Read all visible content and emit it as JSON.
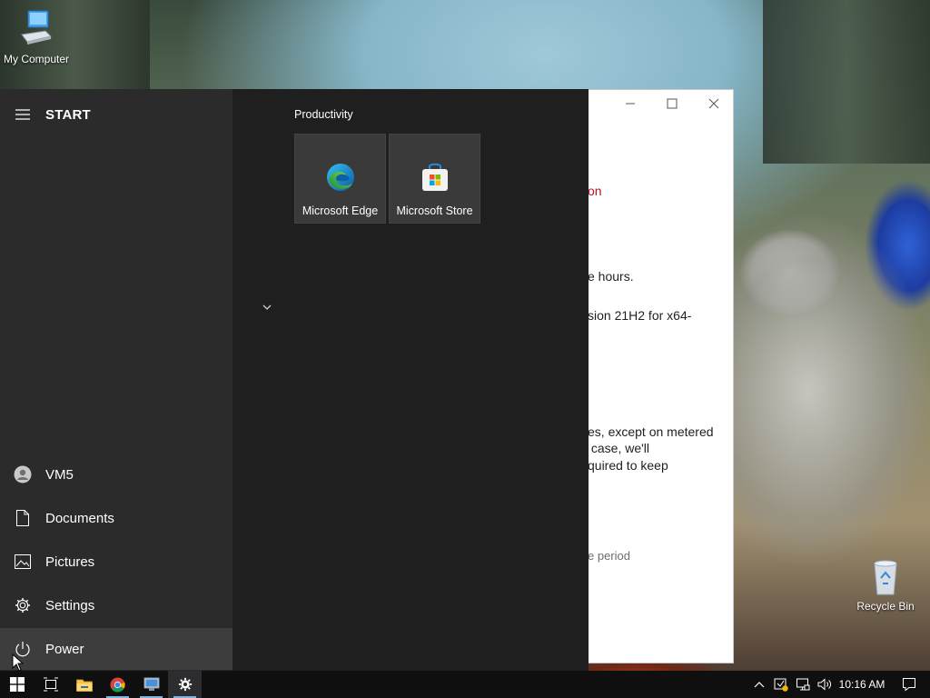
{
  "desktop": {
    "icons": [
      {
        "label": "My Computer"
      },
      {
        "label": "Recycle Bin"
      }
    ]
  },
  "background_window": {
    "text_lines": [
      "on",
      "e hours.",
      "sion 21H2 for x64-",
      "es, except on metered",
      " case, we'll",
      "quired to keep",
      "e period"
    ],
    "colors": {
      "highlight_text": "#c50f1f",
      "muted_text": "#6d6d6d"
    }
  },
  "start_menu": {
    "title": "START",
    "rail": {
      "user": "VM5",
      "documents": "Documents",
      "pictures": "Pictures",
      "settings": "Settings",
      "power": "Power"
    },
    "group_label": "Productivity",
    "tiles": [
      {
        "label": "Microsoft Edge",
        "icon": "edge-icon"
      },
      {
        "label": "Microsoft Store",
        "icon": "store-icon"
      }
    ]
  },
  "taskbar": {
    "apps": [
      "start-button",
      "task-view",
      "file-explorer",
      "chrome",
      "remote-desktop",
      "settings"
    ],
    "clock": "10:16 AM"
  },
  "colors": {
    "start_bg": "#1f1f1f",
    "rail_bg": "#2b2b2b",
    "tile_bg": "#3a3a3a",
    "taskbar_bg": "#0f0f10",
    "accent": "#7fb3e0"
  }
}
